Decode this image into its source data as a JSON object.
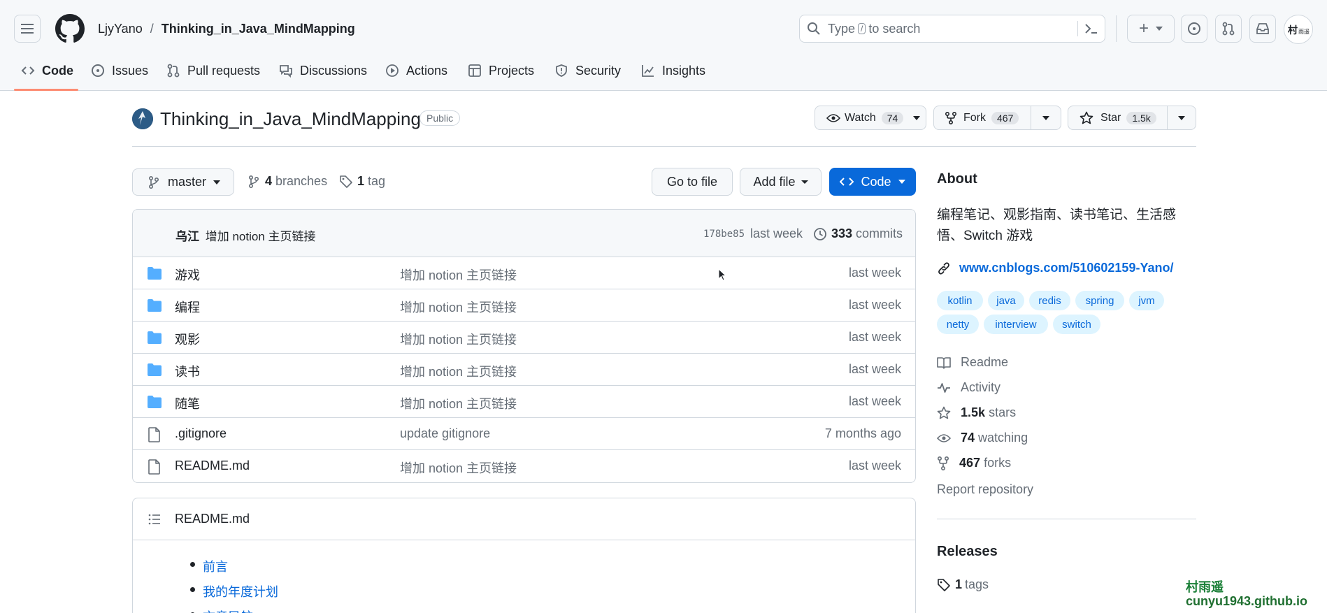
{
  "header": {
    "owner": "LjyYano",
    "separator": "/",
    "repo": "Thinking_in_Java_MindMapping",
    "search_prefix": "Type",
    "search_key": "/",
    "search_suffix": "to search",
    "plus_label": "+"
  },
  "tabs": [
    {
      "label": "Code",
      "icon": "code-icon"
    },
    {
      "label": "Issues",
      "icon": "issue-icon"
    },
    {
      "label": "Pull requests",
      "icon": "pull-request-icon"
    },
    {
      "label": "Discussions",
      "icon": "discussion-icon"
    },
    {
      "label": "Actions",
      "icon": "play-icon"
    },
    {
      "label": "Projects",
      "icon": "table-icon"
    },
    {
      "label": "Security",
      "icon": "shield-icon"
    },
    {
      "label": "Insights",
      "icon": "graph-icon"
    }
  ],
  "repo": {
    "title": "Thinking_in_Java_MindMapping",
    "visibility": "Public",
    "watch_label": "Watch",
    "watch_count": "74",
    "fork_label": "Fork",
    "fork_count": "467",
    "star_label": "Star",
    "star_count": "1.5k"
  },
  "toolbar": {
    "branch": "master",
    "branches_count": "4",
    "branches_label": "branches",
    "tags_count": "1",
    "tags_label": "tag",
    "go_to_file": "Go to file",
    "add_file": "Add file",
    "code": "Code"
  },
  "commit": {
    "author": "乌江",
    "message": "增加 notion 主页链接",
    "hash": "178be85",
    "time": "last week",
    "commits_count": "333",
    "commits_label": "commits"
  },
  "files": [
    {
      "name": "游戏",
      "type": "folder",
      "message": "增加 notion 主页链接",
      "time": "last week"
    },
    {
      "name": "编程",
      "type": "folder",
      "message": "增加 notion 主页链接",
      "time": "last week"
    },
    {
      "name": "观影",
      "type": "folder",
      "message": "增加 notion 主页链接",
      "time": "last week"
    },
    {
      "name": "读书",
      "type": "folder",
      "message": "增加 notion 主页链接",
      "time": "last week"
    },
    {
      "name": "随笔",
      "type": "folder",
      "message": "增加 notion 主页链接",
      "time": "last week"
    },
    {
      "name": ".gitignore",
      "type": "file",
      "message": "update gitignore",
      "time": "7 months ago"
    },
    {
      "name": "README.md",
      "type": "file",
      "message": "增加 notion 主页链接",
      "time": "last week"
    }
  ],
  "readme": {
    "title": "README.md",
    "items": [
      "前言",
      "我的年度计划",
      "文章导航"
    ]
  },
  "about": {
    "heading": "About",
    "description_line1": "编程笔记、观影指南、读书笔记、生活感",
    "description_line2": "悟、Switch 游戏",
    "website": "www.cnblogs.com/510602159-Yano/",
    "topics": [
      "kotlin",
      "java",
      "redis",
      "spring",
      "jvm",
      "netty",
      "interview",
      "switch"
    ],
    "readme": "Readme",
    "activity": "Activity",
    "stars_count": "1.5k",
    "stars_label": "stars",
    "watching_count": "74",
    "watching_label": "watching",
    "forks_count": "467",
    "forks_label": "forks",
    "report": "Report repository"
  },
  "releases": {
    "heading": "Releases",
    "tags_count": "1",
    "tags_label": "tags"
  },
  "watermark": {
    "line1": "村雨遥",
    "line2": "cunyu1943.github.io"
  },
  "colors": {
    "accent": "#0969da",
    "primary_button": "#0969da",
    "folder": "#54aeff",
    "tab_underline": "#fd8c73"
  }
}
